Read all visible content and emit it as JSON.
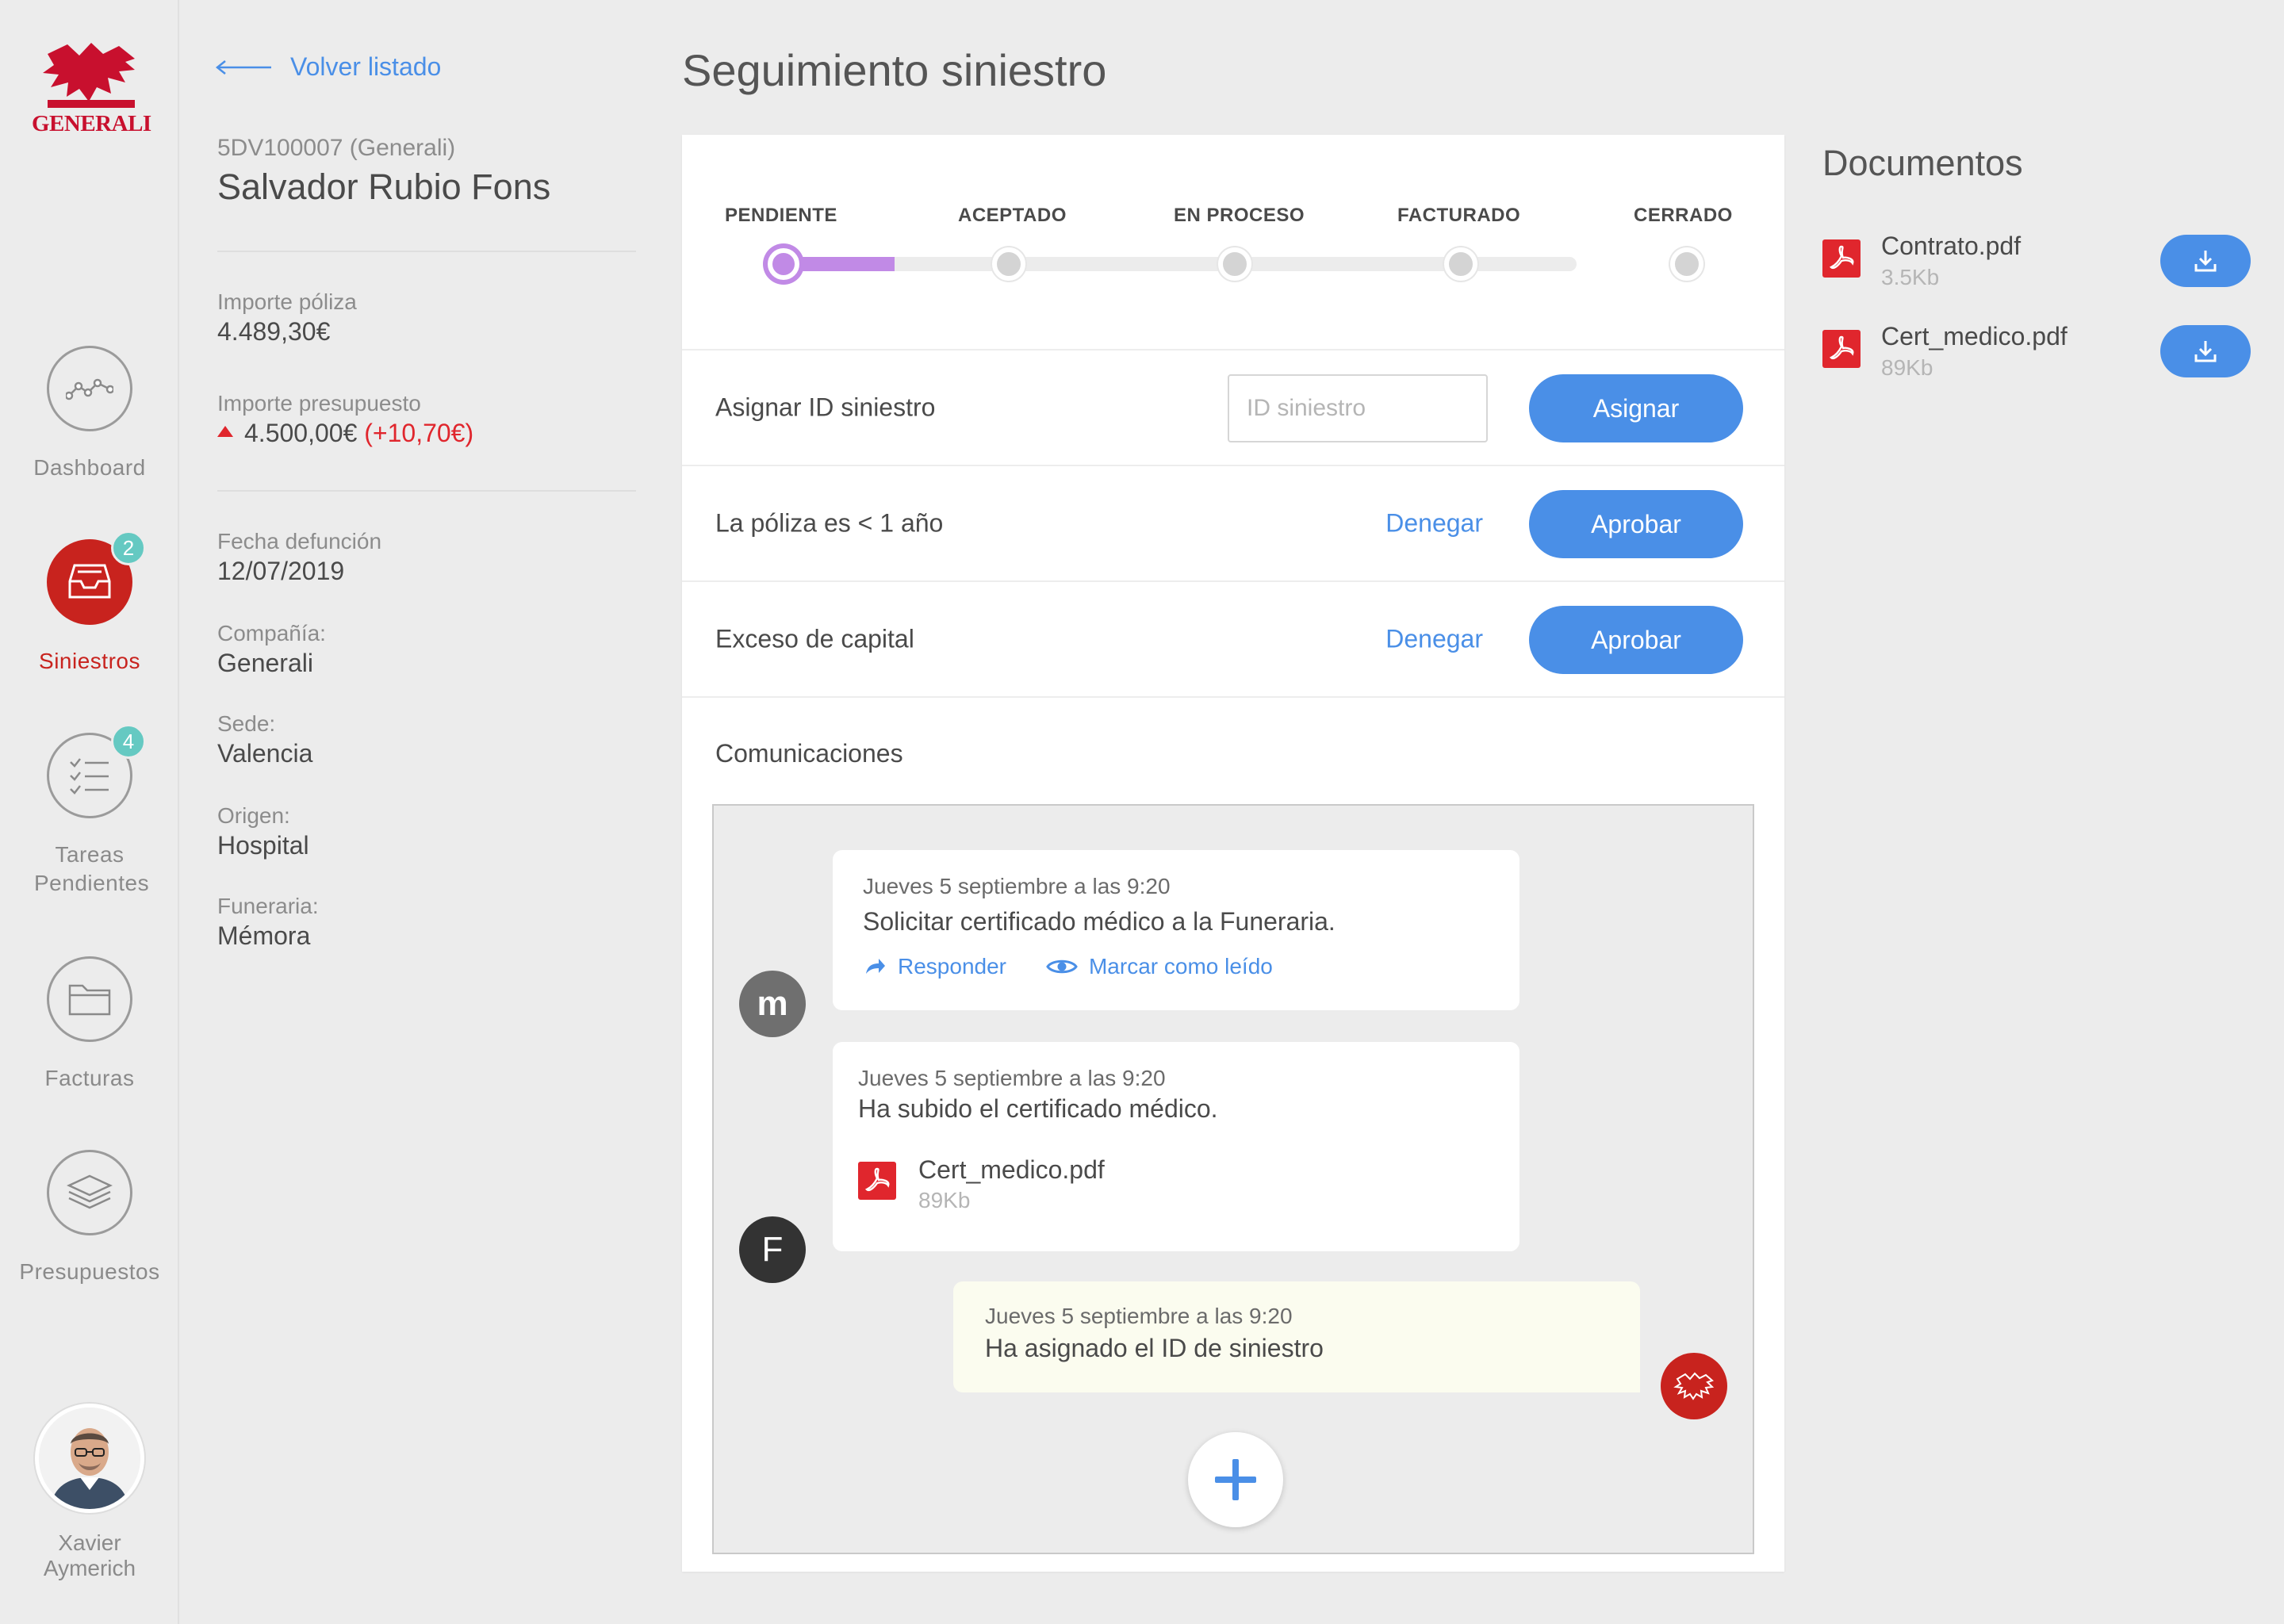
{
  "brand": {
    "name": "GENERALI",
    "color": "#c8102e"
  },
  "nav": {
    "items": [
      {
        "id": "dashboard",
        "label": "Dashboard",
        "icon": "chart-line-icon",
        "badge": ""
      },
      {
        "id": "siniestros",
        "label": "Siniestros",
        "icon": "inbox-icon",
        "badge": "2",
        "active": true
      },
      {
        "id": "tareas",
        "label": "Tareas Pendientes",
        "icon": "checklist-icon",
        "badge": "4"
      },
      {
        "id": "facturas",
        "label": "Facturas",
        "icon": "folder-icon",
        "badge": ""
      },
      {
        "id": "presupuestos",
        "label": "Presupuestos",
        "icon": "layers-icon",
        "badge": ""
      }
    ],
    "user": {
      "first_name": "Xavier",
      "last_name": "Aymerich"
    }
  },
  "back": {
    "label": "Volver listado"
  },
  "claim": {
    "code": "5DV100007 (Generali)",
    "name": "Salvador Rubio Fons",
    "importe_poliza": {
      "label": "Importe póliza",
      "value": "4.489,30€"
    },
    "importe_presupuesto": {
      "label": "Importe presupuesto",
      "value": "4.500,00€",
      "delta": "(+10,70€)"
    },
    "details": [
      {
        "label": "Fecha defunción",
        "value": "12/07/2019"
      },
      {
        "label": "Compañía:",
        "value": "Generali"
      },
      {
        "label": "Sede:",
        "value": "Valencia"
      },
      {
        "label": "Origen:",
        "value": "Hospital"
      },
      {
        "label": "Funeraria:",
        "value": "Mémora"
      }
    ]
  },
  "main": {
    "title": "Seguimiento siniestro",
    "steps": [
      "PENDIENTE",
      "ACEPTADO",
      "EN PROCESO",
      "FACTURADO",
      "CERRADO"
    ],
    "current_step": 0,
    "rows": {
      "assign": {
        "label": "Asignar ID siniestro",
        "placeholder": "ID siniestro",
        "button": "Asignar"
      },
      "poliza": {
        "label": "La póliza es < 1 año",
        "deny": "Denegar",
        "approve": "Aprobar"
      },
      "capital": {
        "label": "Exceso de capital",
        "deny": "Denegar",
        "approve": "Aprobar"
      }
    },
    "comms": {
      "title": "Comunicaciones",
      "messages": [
        {
          "author_initial": "m",
          "date": "Jueves 5 septiembre a las 9:20",
          "text": "Solicitar certificado médico a la Funeraria.",
          "reply": "Responder",
          "mark_read": "Marcar como leído"
        },
        {
          "author_initial": "F",
          "date": "Jueves 5 septiembre a las 9:20",
          "text": "Ha subido el certificado médico.",
          "attachment": {
            "name": "Cert_medico.pdf",
            "size": "89Kb"
          }
        },
        {
          "author_initial": "",
          "date": "Jueves 5 septiembre a las 9:20",
          "text": "Ha asignado el ID de siniestro"
        }
      ]
    }
  },
  "documents": {
    "title": "Documentos",
    "items": [
      {
        "name": "Contrato.pdf",
        "size": "3.5Kb"
      },
      {
        "name": "Cert_medico.pdf",
        "size": "89Kb"
      }
    ]
  },
  "colors": {
    "accent": "#4a8fe7",
    "step": "#c18ae6",
    "badge": "#65c9c2",
    "danger": "#e0262d",
    "own_message": "#fbfcef"
  }
}
